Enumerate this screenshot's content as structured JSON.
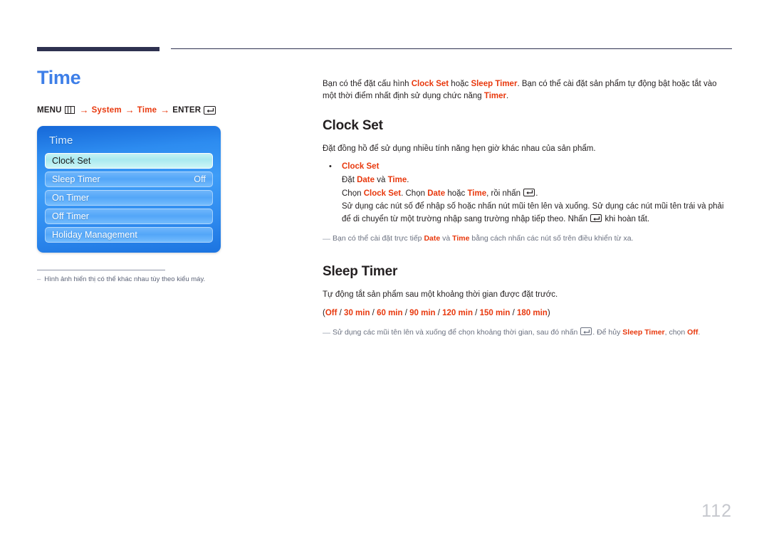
{
  "page": {
    "number": "112"
  },
  "left": {
    "title": "Time",
    "menu_path": {
      "menu_label": "MENU",
      "menu_icon": "menu-icon",
      "arrow": "→",
      "system_label": "System",
      "time_label": "Time",
      "enter_label": "ENTER",
      "enter_icon": "enter-return-icon"
    },
    "osd": {
      "title": "Time",
      "rows": [
        {
          "label": "Clock Set",
          "value": "",
          "selected": true
        },
        {
          "label": "Sleep Timer",
          "value": "Off",
          "selected": false
        },
        {
          "label": "On Timer",
          "value": "",
          "selected": false
        },
        {
          "label": "Off Timer",
          "value": "",
          "selected": false
        },
        {
          "label": "Holiday Management",
          "value": "",
          "selected": false
        }
      ]
    },
    "footnote": {
      "dash": "–",
      "text": "Hình ảnh hiển thị có thể khác nhau tùy theo kiểu máy."
    }
  },
  "right": {
    "intro": {
      "p1": "Bạn có thể đặt cấu hình ",
      "t1": "Clock Set",
      "p2": " hoặc ",
      "t2": "Sleep Timer",
      "p3": ". Bạn có thể cài đặt sản phẩm tự động bật hoặc tắt vào một thời điểm nhất định sử dụng chức năng ",
      "t3": "Timer",
      "p4": "."
    },
    "clock_set": {
      "heading": "Clock Set",
      "desc": "Đặt đồng hồ để sử dụng nhiều tính năng hẹn giờ khác nhau của sản phẩm.",
      "bullet_marker": "•",
      "bullet_label": "Clock Set",
      "line1": {
        "a": "Đặt ",
        "t1": "Date",
        "b": " và ",
        "t2": "Time",
        "c": "."
      },
      "line2": {
        "a": "Chọn ",
        "t1": "Clock Set",
        "b": ". Chọn ",
        "t2": "Date",
        "c": " hoặc ",
        "t3": "Time",
        "d": ", rồi nhấn ",
        "e": "."
      },
      "line3": {
        "a": "Sử dụng các nút số để nhập số hoặc nhấn nút mũi tên lên và xuống. Sử dụng các nút mũi tên trái và phải để di chuyển từ một trường nhập sang trường nhập tiếp theo. Nhấn ",
        "b": " khi hoàn tất."
      },
      "note": {
        "dash": "—",
        "a": "Bạn có thể cài đặt trực tiếp ",
        "t1": "Date",
        "b": " và ",
        "t2": "Time",
        "c": " bằng cách nhấn các nút số trên điều khiển từ xa."
      }
    },
    "sleep_timer": {
      "heading": "Sleep Timer",
      "desc": "Tự động tắt sản phẩm sau một khoảng thời gian được đặt trước.",
      "options_open": "(",
      "options": [
        "Off",
        "30 min",
        "60 min",
        "90 min",
        "120 min",
        "150 min",
        "180 min"
      ],
      "options_sep": " / ",
      "options_close": ")",
      "note": {
        "dash": "—",
        "a": "Sử dụng các mũi tên lên và xuống để chọn khoảng thời gian, sau đó nhấn ",
        "b": ". Để hủy ",
        "t1": "Sleep Timer",
        "c": ", chọn ",
        "t2": "Off",
        "d": "."
      }
    }
  },
  "colors": {
    "accent_blue": "#3e7fe8",
    "accent_red": "#e8380d",
    "rule_navy": "#2e3150",
    "page_num_gray": "#c6c8ce"
  }
}
